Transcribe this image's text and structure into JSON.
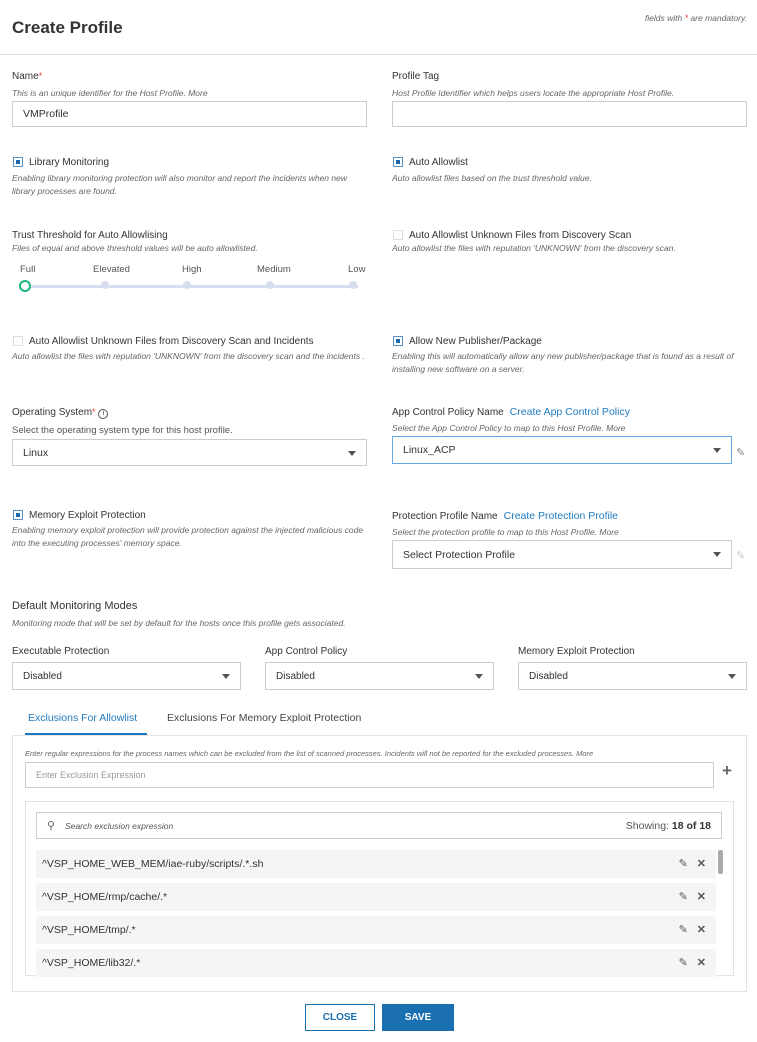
{
  "header": {
    "title": "Create Profile",
    "mandatory_prefix": "fields with ",
    "mandatory_star": "*",
    "mandatory_suffix": " are mandatory."
  },
  "name": {
    "label": "Name",
    "help": "This is an unique identifier for the Host Profile. More",
    "value": "VMProfile"
  },
  "profile_tag": {
    "label": "Profile Tag",
    "help": "Host Profile Identifier which helps users locate the appropriate Host Profile.",
    "value": ""
  },
  "library_monitoring": {
    "label": "Library Monitoring",
    "checked": true,
    "help": "Enabling library monitoring protection will also monitor and report the incidents when new library processes are found."
  },
  "auto_allowlist": {
    "label": "Auto Allowlist",
    "checked": true,
    "help": "Auto allowlist files based on the trust threshold value."
  },
  "trust_threshold": {
    "label": "Trust Threshold for Auto Allowlising",
    "help": "Files of equal and above threshold values will be auto allowlisted.",
    "levels": [
      "Full",
      "Elevated",
      "High",
      "Medium",
      "Low"
    ],
    "selected": "Full"
  },
  "auto_unknown_scan": {
    "label": "Auto Allowlist Unknown Files from Discovery Scan",
    "checked": false,
    "help": "Auto allowlist the files with reputation 'UNKNOWN' from the discovery scan."
  },
  "auto_unknown_scan_incidents": {
    "label": "Auto Allowlist Unknown Files from Discovery Scan and Incidents",
    "checked": false,
    "help": "Auto allowlist the files with reputation 'UNKNOWN' from the discovery scan and the incidents ."
  },
  "allow_publisher": {
    "label": "Allow New Publisher/Package",
    "checked": true,
    "help": "Enabling this will automatically allow any new publisher/package that is found as a result of installing new software on a server."
  },
  "os": {
    "label": "Operating System",
    "help": "Select the operating system type for this host profile.",
    "value": "Linux"
  },
  "app_control": {
    "label": "App Control Policy Name",
    "link": "Create App Control Policy",
    "help": "Select the App Control Policy to map to this Host Profile. More",
    "value": "Linux_ACP"
  },
  "memory_exploit": {
    "label": "Memory Exploit Protection",
    "checked": true,
    "help": "Enabling memory exploit protection will provide protection against the injected malicious code into the executing processes' memory space."
  },
  "protection_profile": {
    "label": "Protection Profile Name",
    "link": "Create Protection Profile",
    "help": "Select the protection profile to map to this Host Profile. More",
    "value": "Select Protection Profile"
  },
  "monitoring": {
    "title": "Default Monitoring Modes",
    "help": "Monitoring mode that will be set by default for the hosts once this profile gets associated.",
    "executable": {
      "label": "Executable Protection",
      "value": "Disabled"
    },
    "app_control": {
      "label": "App Control Policy",
      "value": "Disabled"
    },
    "memory": {
      "label": "Memory Exploit Protection",
      "value": "Disabled"
    }
  },
  "tabs": [
    {
      "label": "Exclusions For Allowlist",
      "active": true
    },
    {
      "label": "Exclusions For Memory Exploit Protection",
      "active": false
    }
  ],
  "exclusions": {
    "help": "Enter regular expressions for the process names which can be excluded from the list of scanned processes. Incidents will not be reported for the excluded processes. More",
    "placeholder": "Enter Exclusion Expression",
    "search_placeholder": "Search exclusion expression",
    "showing_label": "Showing: ",
    "showing_count": "18 of 18",
    "items": [
      "^VSP_HOME_WEB_MEM/iae-ruby/scripts/.*.sh",
      "^VSP_HOME/rmp/cache/.*",
      "^VSP_HOME/tmp/.*",
      "^VSP_HOME/lib32/.*"
    ]
  },
  "footer": {
    "close": "CLOSE",
    "save": "SAVE"
  },
  "colors": {
    "accent": "#1f7bc1",
    "save_bg": "#1a6fb0",
    "slider_knob": "#1db57a"
  }
}
